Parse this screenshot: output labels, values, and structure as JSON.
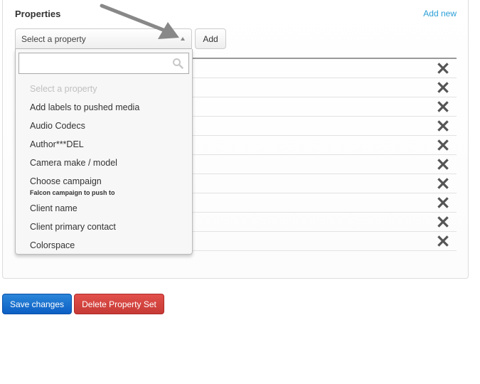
{
  "section": {
    "title": "Properties",
    "add_new_link": "Add new"
  },
  "property_select": {
    "selected_label": "Select a property",
    "state": "open",
    "add_button": "Add",
    "search": {
      "value": "",
      "placeholder": ""
    },
    "options": [
      {
        "label": "Select a property",
        "placeholder": true
      },
      {
        "label": "Add labels to pushed media"
      },
      {
        "label": "Audio Codecs"
      },
      {
        "label": "Author***DEL"
      },
      {
        "label": "Camera make / model"
      },
      {
        "label": "Choose campaign",
        "description": "Falcon campaign to push to"
      },
      {
        "label": "Client name"
      },
      {
        "label": "Client primary contact"
      },
      {
        "label": "Colorspace"
      }
    ]
  },
  "properties_table": {
    "row_count": 10,
    "remove_icon": "close-x-icon"
  },
  "actions": {
    "save_label": "Save changes",
    "delete_label": "Delete Property Set"
  },
  "colors": {
    "link": "#2a9fd6",
    "primary_button": "#0c5fc4",
    "danger_button": "#c63a35",
    "annotation_arrow": "#888888"
  }
}
